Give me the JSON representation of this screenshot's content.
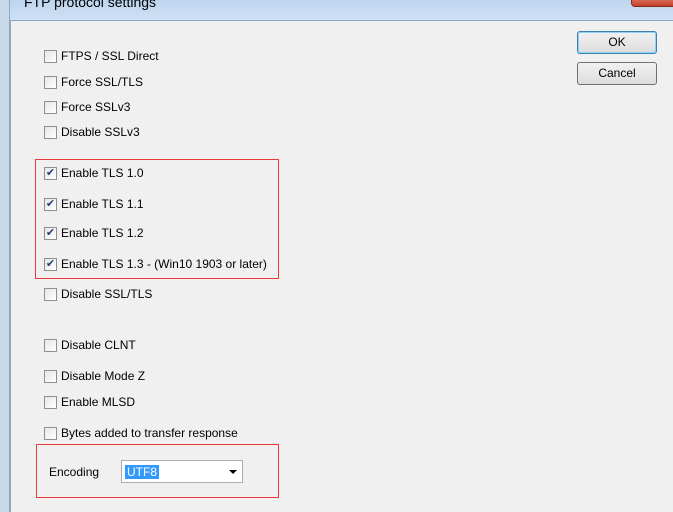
{
  "window": {
    "title": "FTP protocol settings"
  },
  "buttons": {
    "ok": "OK",
    "cancel": "Cancel"
  },
  "options": [
    {
      "label": "FTPS / SSL Direct",
      "checked": false
    },
    {
      "label": "Force SSL/TLS",
      "checked": false
    },
    {
      "label": "Force SSLv3",
      "checked": false
    },
    {
      "label": "Disable SSLv3",
      "checked": false
    },
    {
      "label": "Enable TLS 1.0",
      "checked": true
    },
    {
      "label": "Enable TLS 1.1",
      "checked": true
    },
    {
      "label": "Enable TLS 1.2",
      "checked": true
    },
    {
      "label": "Enable TLS 1.3 - (Win10 1903 or later)",
      "checked": true
    },
    {
      "label": "Disable SSL/TLS",
      "checked": false
    },
    {
      "label": "Disable CLNT",
      "checked": false
    },
    {
      "label": "Disable Mode Z",
      "checked": false
    },
    {
      "label": "Enable MLSD",
      "checked": false
    },
    {
      "label": "Bytes added to transfer response",
      "checked": false
    }
  ],
  "encoding": {
    "label": "Encoding",
    "value": "UTF8"
  },
  "colors": {
    "highlight_box": "#e83a3a",
    "selection": "#3399ff"
  }
}
